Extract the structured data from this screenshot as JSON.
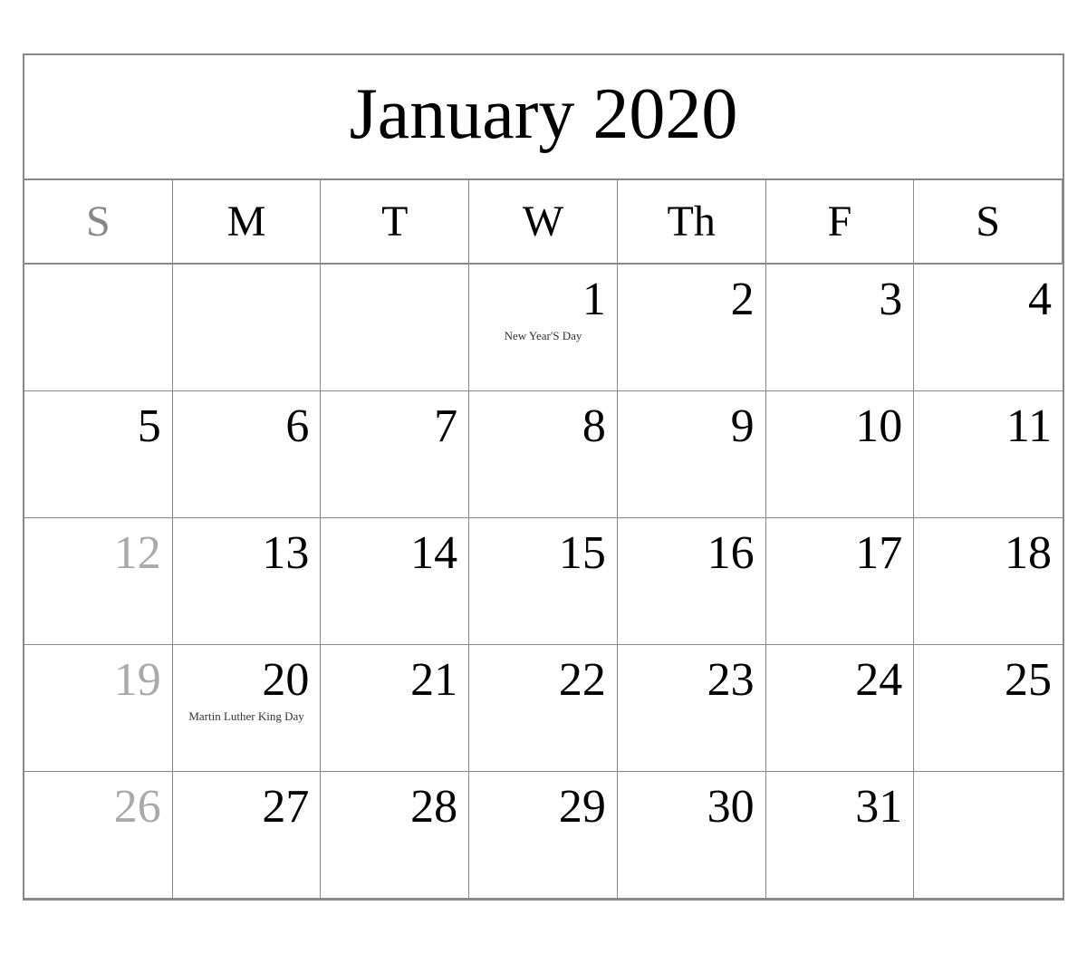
{
  "calendar": {
    "title": "January 2020",
    "headers": [
      {
        "label": "S",
        "black": false
      },
      {
        "label": "M",
        "black": true
      },
      {
        "label": "T",
        "black": true
      },
      {
        "label": "W",
        "black": true
      },
      {
        "label": "Th",
        "black": true
      },
      {
        "label": "F",
        "black": true
      },
      {
        "label": "S",
        "black": true
      }
    ],
    "weeks": [
      [
        {
          "day": "",
          "gray": false,
          "note": ""
        },
        {
          "day": "",
          "gray": false,
          "note": ""
        },
        {
          "day": "",
          "gray": false,
          "note": ""
        },
        {
          "day": "1",
          "gray": false,
          "note": "New Year'S Day"
        },
        {
          "day": "2",
          "gray": false,
          "note": ""
        },
        {
          "day": "3",
          "gray": false,
          "note": ""
        },
        {
          "day": "4",
          "gray": false,
          "note": ""
        }
      ],
      [
        {
          "day": "5",
          "gray": false,
          "note": ""
        },
        {
          "day": "6",
          "gray": false,
          "note": ""
        },
        {
          "day": "7",
          "gray": false,
          "note": ""
        },
        {
          "day": "8",
          "gray": false,
          "note": ""
        },
        {
          "day": "9",
          "gray": false,
          "note": ""
        },
        {
          "day": "10",
          "gray": false,
          "note": ""
        },
        {
          "day": "11",
          "gray": false,
          "note": ""
        }
      ],
      [
        {
          "day": "12",
          "gray": true,
          "note": ""
        },
        {
          "day": "13",
          "gray": false,
          "note": ""
        },
        {
          "day": "14",
          "gray": false,
          "note": ""
        },
        {
          "day": "15",
          "gray": false,
          "note": ""
        },
        {
          "day": "16",
          "gray": false,
          "note": ""
        },
        {
          "day": "17",
          "gray": false,
          "note": ""
        },
        {
          "day": "18",
          "gray": false,
          "note": ""
        }
      ],
      [
        {
          "day": "19",
          "gray": true,
          "note": ""
        },
        {
          "day": "20",
          "gray": false,
          "note": "Martin Luther\nKing Day"
        },
        {
          "day": "21",
          "gray": false,
          "note": ""
        },
        {
          "day": "22",
          "gray": false,
          "note": ""
        },
        {
          "day": "23",
          "gray": false,
          "note": ""
        },
        {
          "day": "24",
          "gray": false,
          "note": ""
        },
        {
          "day": "25",
          "gray": false,
          "note": ""
        }
      ],
      [
        {
          "day": "26",
          "gray": true,
          "note": ""
        },
        {
          "day": "27",
          "gray": false,
          "note": ""
        },
        {
          "day": "28",
          "gray": false,
          "note": ""
        },
        {
          "day": "29",
          "gray": false,
          "note": ""
        },
        {
          "day": "30",
          "gray": false,
          "note": ""
        },
        {
          "day": "31",
          "gray": false,
          "note": ""
        },
        {
          "day": "",
          "gray": false,
          "note": ""
        }
      ]
    ]
  }
}
